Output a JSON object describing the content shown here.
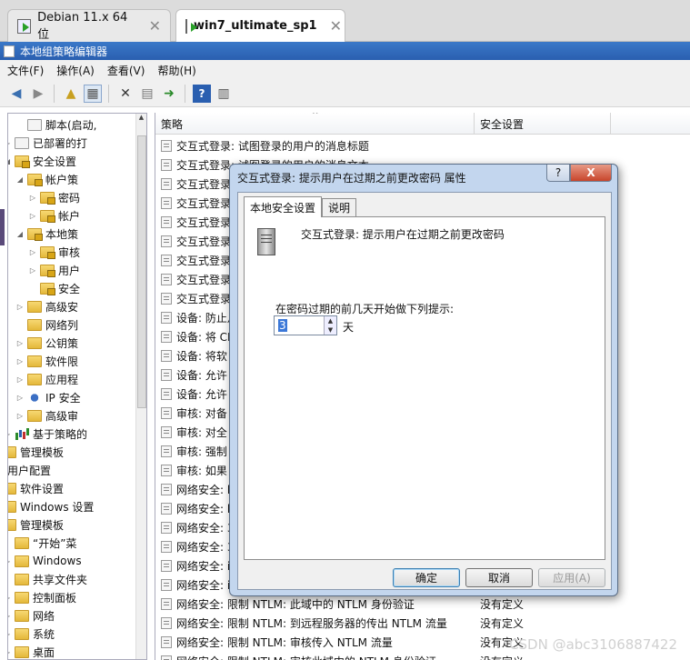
{
  "browser_tabs": [
    {
      "label": "Debian 11.x 64 位",
      "active": false
    },
    {
      "label": "win7_ultimate_sp1",
      "active": true
    }
  ],
  "window_title": "本地组策略编辑器",
  "menu": [
    "文件(F)",
    "操作(A)",
    "查看(V)",
    "帮助(H)"
  ],
  "toolbar_icons": [
    "back-icon",
    "forward-icon",
    "up-folder-icon",
    "show-hide-tree-icon",
    "delete-icon",
    "properties-icon",
    "export-icon",
    "help-icon",
    "view-icon"
  ],
  "tree": [
    {
      "label": "脚本(启动,",
      "icon": "doc",
      "arrow": ""
    },
    {
      "label": "已部署的打",
      "icon": "doc",
      "arrow": "▷"
    },
    {
      "label": "安全设置",
      "icon": "lock",
      "arrow": "◢"
    },
    {
      "label": "帐户策",
      "icon": "lock",
      "arrow": "◢"
    },
    {
      "label": "密码",
      "icon": "lock",
      "arrow": "▷"
    },
    {
      "label": "帐户",
      "icon": "lock",
      "arrow": "▷"
    },
    {
      "label": "本地策",
      "icon": "lock",
      "arrow": "◢"
    },
    {
      "label": "审核",
      "icon": "lock",
      "arrow": "▷"
    },
    {
      "label": "用户",
      "icon": "lock",
      "arrow": "▷"
    },
    {
      "label": "安全",
      "icon": "lock",
      "arrow": ""
    },
    {
      "label": "高级安",
      "icon": "folder",
      "arrow": "▷"
    },
    {
      "label": "网络列",
      "icon": "folder",
      "arrow": ""
    },
    {
      "label": "公钥策",
      "icon": "folder",
      "arrow": "▷"
    },
    {
      "label": "软件限",
      "icon": "folder",
      "arrow": "▷"
    },
    {
      "label": "应用程",
      "icon": "folder",
      "arrow": "▷"
    },
    {
      "label": "IP 安全",
      "icon": "ip",
      "arrow": "▷"
    },
    {
      "label": "高级审",
      "icon": "folder",
      "arrow": "▷"
    },
    {
      "label": "基于策略的",
      "icon": "chart",
      "arrow": "▷"
    },
    {
      "label": "管理模板",
      "icon": "folder",
      "arrow": "▷"
    },
    {
      "label": "用户配置",
      "icon": "user",
      "arrow": "◢"
    },
    {
      "label": "软件设置",
      "icon": "folder",
      "arrow": "▷"
    },
    {
      "label": "Windows 设置",
      "icon": "folder",
      "arrow": "▷"
    },
    {
      "label": "管理模板",
      "icon": "folder",
      "arrow": "◢"
    },
    {
      "label": "“开始”菜",
      "icon": "folder",
      "arrow": ""
    },
    {
      "label": "Windows",
      "icon": "folder",
      "arrow": "▷"
    },
    {
      "label": "共享文件夹",
      "icon": "folder",
      "arrow": ""
    },
    {
      "label": "控制面板",
      "icon": "folder",
      "arrow": "▷"
    },
    {
      "label": "网络",
      "icon": "folder",
      "arrow": "▷"
    },
    {
      "label": "系统",
      "icon": "folder",
      "arrow": "▷"
    },
    {
      "label": "桌面",
      "icon": "folder",
      "arrow": "▷"
    }
  ],
  "tree_indents": [
    4,
    3,
    3,
    4,
    5,
    5,
    4,
    5,
    5,
    5,
    4,
    4,
    4,
    4,
    4,
    4,
    4,
    3,
    2,
    1,
    2,
    2,
    2,
    3,
    3,
    3,
    3,
    3,
    3,
    3
  ],
  "columns": {
    "policy": "策略",
    "setting": "安全设置"
  },
  "policies": [
    {
      "name": "交互式登录: 试图登录的用户的消息标题",
      "value": ""
    },
    {
      "name": "交互式登录: 试图登录的用户的消息文本",
      "value": ""
    },
    {
      "name": "交互式登录",
      "value": ""
    },
    {
      "name": "交互式登录",
      "value": ""
    },
    {
      "name": "交互式登录",
      "value": ""
    },
    {
      "name": "交互式登录",
      "value": ""
    },
    {
      "name": "交互式登录",
      "value": ""
    },
    {
      "name": "交互式登录",
      "value": ""
    },
    {
      "name": "交互式登录",
      "value": ""
    },
    {
      "name": "设备: 防止月",
      "value": ""
    },
    {
      "name": "设备: 将 CI",
      "value": ""
    },
    {
      "name": "设备: 将软",
      "value": ""
    },
    {
      "name": "设备: 允许",
      "value": ""
    },
    {
      "name": "设备: 允许",
      "value": ""
    },
    {
      "name": "审核: 对备",
      "value": ""
    },
    {
      "name": "审核: 对全",
      "value": ""
    },
    {
      "name": "审核: 强制",
      "value": ""
    },
    {
      "name": "审核: 如果",
      "value": ""
    },
    {
      "name": "网络安全: l",
      "value": ""
    },
    {
      "name": "网络安全: l",
      "value": ""
    },
    {
      "name": "网络安全: 3",
      "value": ""
    },
    {
      "name": "网络安全: 3",
      "value": ""
    },
    {
      "name": "网络安全: i",
      "value": ""
    },
    {
      "name": "网络安全: i",
      "value": ""
    },
    {
      "name": "网络安全: 限制 NTLM: 此域中的 NTLM 身份验证",
      "value": "没有定义"
    },
    {
      "name": "网络安全: 限制 NTLM: 到远程服务器的传出 NTLM 流量",
      "value": "没有定义"
    },
    {
      "name": "网络安全: 限制 NTLM: 审核传入 NTLM 流量",
      "value": "没有定义"
    },
    {
      "name": "网络安全: 限制 NTLM: 审核此域中的 NTLM 身份验证",
      "value": "没有定义"
    }
  ],
  "dialog": {
    "title": "交互式登录: 提示用户在过期之前更改密码 属性",
    "help_button": "?",
    "close_button": "X",
    "tabs": [
      "本地安全设置",
      "说明"
    ],
    "policy_title": "交互式登录: 提示用户在过期之前更改密码",
    "prompt_label": "在密码过期的前几天开始做下列提示:",
    "days_value": "3",
    "days_unit": "天",
    "buttons": {
      "ok": "确定",
      "cancel": "取消",
      "apply": "应用(A)"
    }
  },
  "watermark": "CSDN @abc3106887422"
}
